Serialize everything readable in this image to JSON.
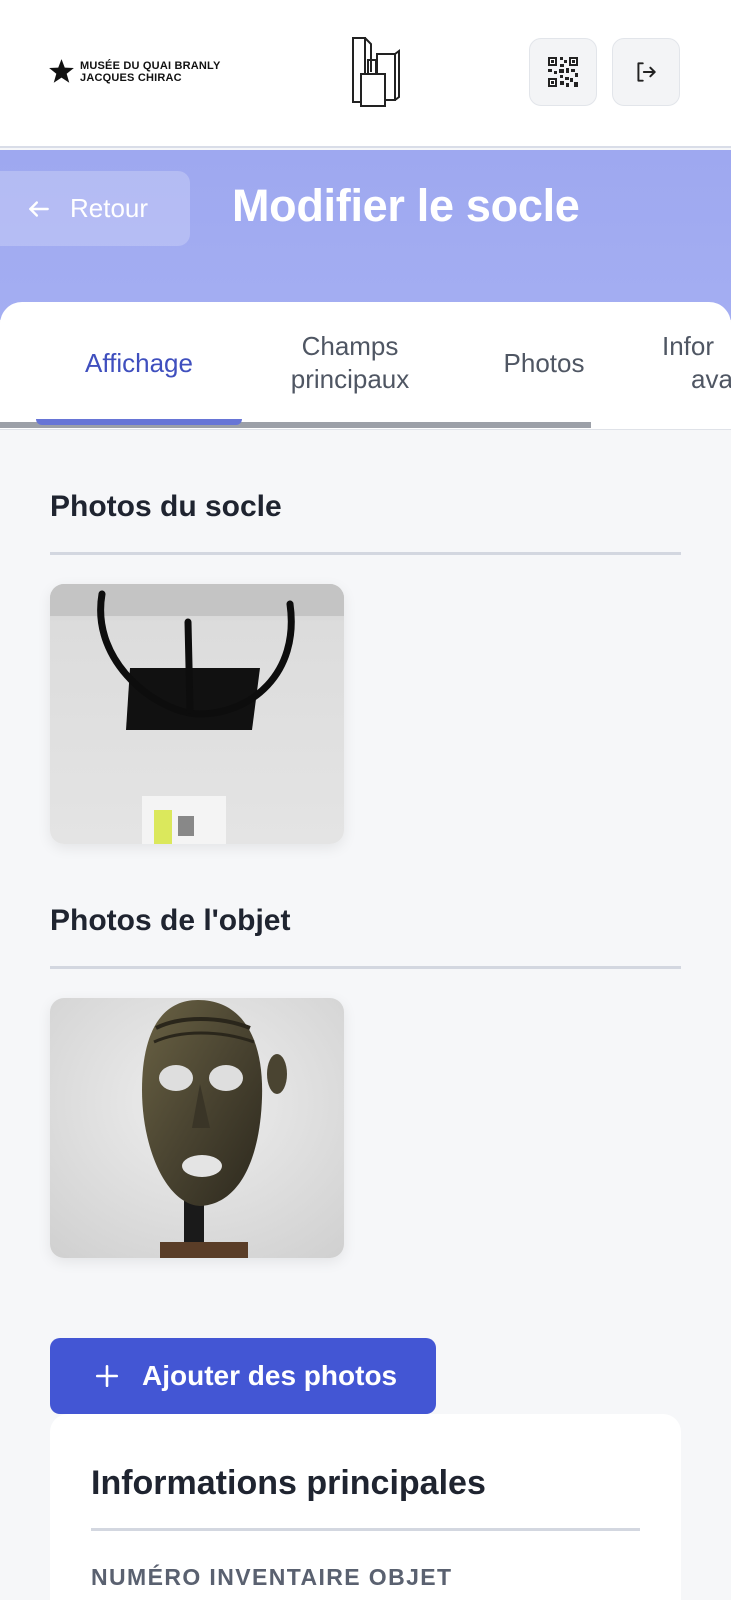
{
  "header": {
    "logo_line1": "MUSÉE DU QUAI BRANLY",
    "logo_line2": "JACQUES CHIRAC",
    "qr_icon": "qr-code-icon",
    "logout_icon": "logout-icon"
  },
  "nav": {
    "back_label": "Retour",
    "back_icon": "arrow-left-icon",
    "title": "Modifier le socle"
  },
  "tabs": [
    {
      "line1": "Affichage",
      "line2": "",
      "active": true
    },
    {
      "line1": "Champs",
      "line2": "principaux",
      "active": false
    },
    {
      "line1": "Photos",
      "line2": "",
      "active": false
    },
    {
      "line1": "Infor",
      "line2": "ava",
      "active": false
    }
  ],
  "sections": {
    "socle_photos_title": "Photos du socle",
    "object_photos_title": "Photos de l'objet"
  },
  "add_photos": {
    "label": "Ajouter des photos",
    "icon": "plus-icon"
  },
  "info_card": {
    "title": "Informations principales",
    "field_label": "NUMÉRO INVENTAIRE OBJET"
  },
  "colors": {
    "accent": "#4356d4",
    "band": "#a0aaf1",
    "active_tab": "#3f4fbe"
  }
}
